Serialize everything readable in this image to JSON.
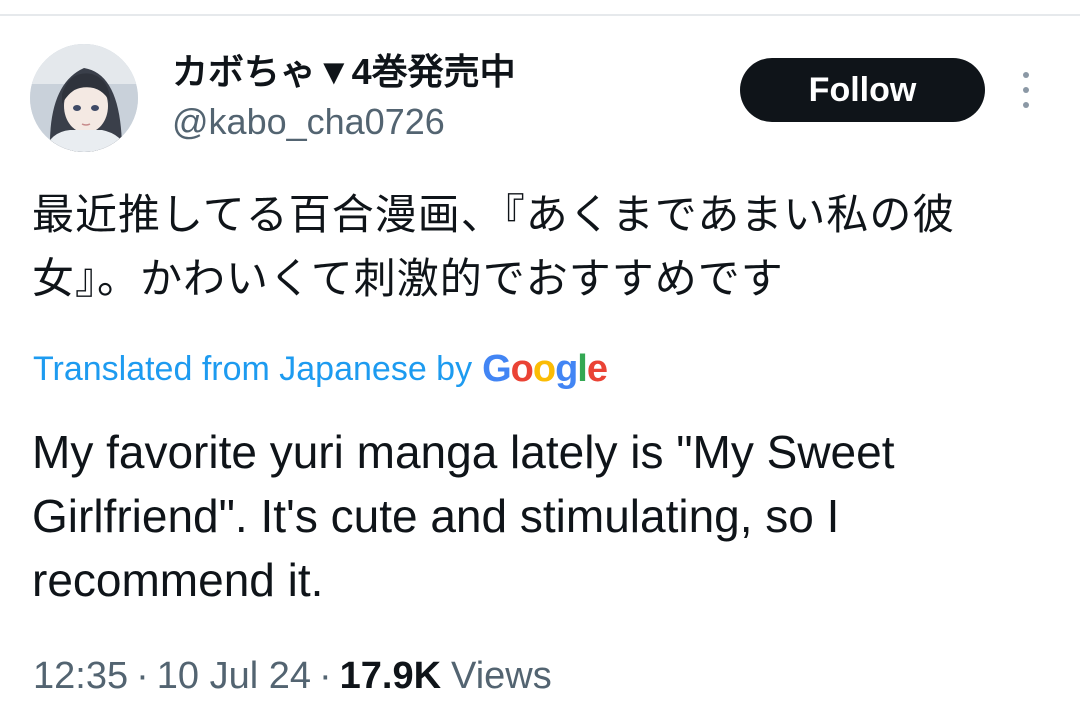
{
  "author": {
    "display_name": "カボちゃ▼4巻発売中",
    "handle": "@kabo_cha0726",
    "avatar_icon": "avatar-illustration-icon"
  },
  "actions": {
    "follow_label": "Follow",
    "more_icon": "more-options-icon"
  },
  "tweet": {
    "original_text": "最近推してる百合漫画、『あくまであまい私の彼女』。かわいくて刺激的でおすすめです",
    "translated_by_label": "Translated from Japanese by",
    "translator_brand": {
      "G": "G",
      "o1": "o",
      "o2": "o",
      "g": "g",
      "l": "l",
      "e": "e"
    },
    "translated_text": "My favorite yuri manga lately is \"My Sweet Girlfriend\". It's cute and stimulating, so I recommend it."
  },
  "meta": {
    "time": "12:35",
    "separator": "·",
    "date": "10 Jul 24",
    "views_count": "17.9K",
    "views_label": "Views"
  },
  "colors": {
    "text_primary": "#0f1419",
    "text_secondary": "#536471",
    "link_blue": "#1d9bf0",
    "button_bg": "#0f1419",
    "google_blue": "#4285f4",
    "google_red": "#ea4335",
    "google_yellow": "#fbbc05",
    "google_green": "#34a853"
  }
}
